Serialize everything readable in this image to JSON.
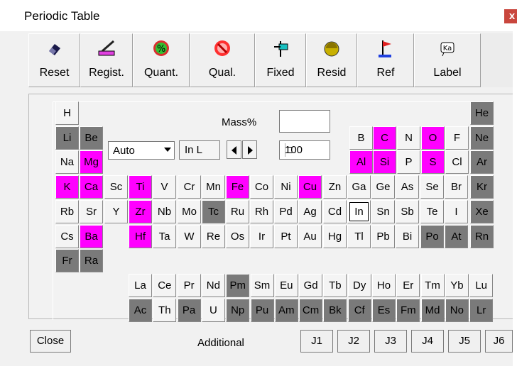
{
  "window": {
    "title": "Periodic Table",
    "close_symbol": "x"
  },
  "toolbar": {
    "buttons": [
      {
        "label": "Reset",
        "icon": "eraser-icon"
      },
      {
        "label": "Regist.",
        "icon": "register-pen-icon"
      },
      {
        "label": "Quant.",
        "icon": "quant-percent-icon"
      },
      {
        "label": "Qual.",
        "icon": "qual-no-icon"
      },
      {
        "label": "Fixed",
        "icon": "fixed-pin-icon"
      },
      {
        "label": "Resid",
        "icon": "resid-ball-icon"
      },
      {
        "label": "Ref",
        "icon": "ref-flag-icon"
      },
      {
        "label": "Label",
        "icon": "label-ka-icon"
      }
    ]
  },
  "controls": {
    "mass_label": "Mass%",
    "mass_value": "",
    "auto_value": "Auto",
    "in_l": "In L",
    "spin_value": "100"
  },
  "colors": {
    "quantified": "#ff00ff",
    "excluded": "#7a7a7a",
    "selected_outline": "#000000"
  },
  "elements": {
    "H": "n",
    "He": "g",
    "Li": "g",
    "Be": "g",
    "B": "n",
    "C": "q",
    "N": "n",
    "O": "q",
    "F": "n",
    "Ne": "g",
    "Na": "n",
    "Mg": "q",
    "Al": "q",
    "Si": "q",
    "P": "n",
    "S": "q",
    "Cl": "n",
    "Ar": "g",
    "K": "q",
    "Ca": "q",
    "Sc": "n",
    "Ti": "q",
    "V": "n",
    "Cr": "n",
    "Mn": "n",
    "Fe": "q",
    "Co": "n",
    "Ni": "n",
    "Cu": "q",
    "Zn": "n",
    "Ga": "n",
    "Ge": "n",
    "As": "n",
    "Se": "n",
    "Br": "n",
    "Kr": "g",
    "Rb": "n",
    "Sr": "n",
    "Y": "n",
    "Zr": "q",
    "Nb": "n",
    "Mo": "n",
    "Tc": "g",
    "Ru": "n",
    "Rh": "n",
    "Pd": "n",
    "Ag": "n",
    "Cd": "n",
    "In": "o",
    "Sn": "n",
    "Sb": "n",
    "Te": "n",
    "I": "n",
    "Xe": "g",
    "Cs": "n",
    "Ba": "q",
    "Hf": "q",
    "Ta": "n",
    "W": "n",
    "Re": "n",
    "Os": "n",
    "Ir": "n",
    "Pt": "n",
    "Au": "n",
    "Hg": "n",
    "Tl": "n",
    "Pb": "n",
    "Bi": "n",
    "Po": "g",
    "At": "g",
    "Rn": "g",
    "Fr": "g",
    "Ra": "g",
    "La": "n",
    "Ce": "n",
    "Pr": "n",
    "Nd": "n",
    "Pm": "g",
    "Sm": "n",
    "Eu": "n",
    "Gd": "n",
    "Tb": "n",
    "Dy": "n",
    "Ho": "n",
    "Er": "n",
    "Tm": "n",
    "Yb": "n",
    "Lu": "n",
    "Ac": "g",
    "Th": "n",
    "Pa": "g",
    "U": "n",
    "Np": "g",
    "Pu": "g",
    "Am": "g",
    "Cm": "g",
    "Bk": "g",
    "Cf": "g",
    "Es": "g",
    "Fm": "g",
    "Md": "g",
    "No": "g",
    "Lr": "g"
  },
  "bottom": {
    "close": "Close",
    "additional": "Additional",
    "j": [
      "J1",
      "J2",
      "J3",
      "J4",
      "J5",
      "J6"
    ]
  }
}
